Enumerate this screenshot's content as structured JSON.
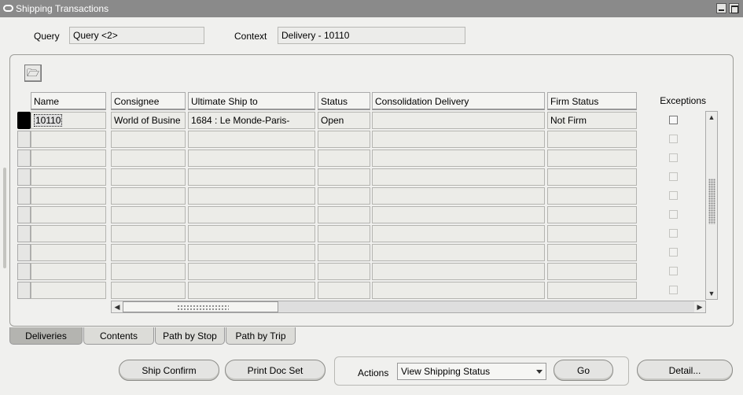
{
  "window": {
    "title": "Shipping Transactions"
  },
  "query": {
    "label": "Query",
    "value": "Query <2>"
  },
  "context": {
    "label": "Context",
    "value": "Delivery - 10110"
  },
  "toolbar": {
    "open_icon": "folder-open-icon"
  },
  "table": {
    "columns": [
      "Name",
      "Consignee",
      "Ultimate Ship to",
      "Status",
      "Consolidation Delivery",
      "Firm Status",
      "Exceptions"
    ],
    "rows": [
      {
        "name": "10110",
        "consignee": "World of Busine",
        "ship_to": "1684 : Le Monde-Paris-",
        "status": "Open",
        "consolidation": "",
        "firm_status": "Not Firm",
        "exceptions": false
      }
    ]
  },
  "tabs": [
    {
      "label": "Deliveries",
      "active": true
    },
    {
      "label": "Contents",
      "active": false
    },
    {
      "label": "Path by Stop",
      "active": false
    },
    {
      "label": "Path by Trip",
      "active": false
    }
  ],
  "buttons": {
    "ship_confirm": "Ship Confirm",
    "print_doc_set": "Print Doc Set",
    "actions_label": "Actions",
    "actions_value": "View Shipping Status",
    "go": "Go",
    "detail": "Detail..."
  }
}
